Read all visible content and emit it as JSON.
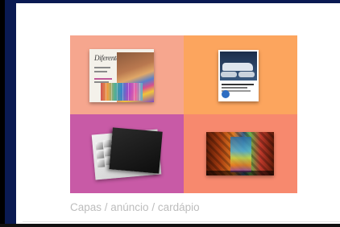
{
  "gallery": {
    "items": [
      {
        "name": "magazine-cover-thumbnail",
        "bg": "#f6a68e",
        "mast": "Diferente"
      },
      {
        "name": "car-ad-thumbnail",
        "bg": "#fca55e"
      },
      {
        "name": "packaging-box-thumbnail",
        "bg": "#c85aa6"
      },
      {
        "name": "menu-thumbnail",
        "bg": "#f7896e"
      }
    ],
    "caption": "Capas / anúncio / cardápio"
  }
}
